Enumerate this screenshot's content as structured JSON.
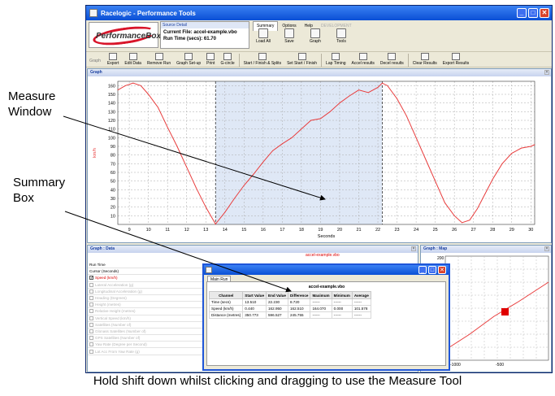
{
  "annotations": {
    "measure": [
      "Measure",
      "Window"
    ],
    "summary": [
      "Summary",
      "Box"
    ],
    "caption": "Hold shift down whilst clicking and dragging to use the Measure Tool"
  },
  "window": {
    "title": "Racelogic - Performance Tools"
  },
  "logo": {
    "text": "PerformanceBox"
  },
  "source_detail": {
    "header": "Source Detail",
    "current_file": "Current File: accel-example.vbo",
    "run_time": "Run Time (secs): 61.70"
  },
  "menu": {
    "tabs": [
      {
        "label": "Summary",
        "active": true
      },
      {
        "label": "Options",
        "active": false
      },
      {
        "label": "Help",
        "active": false
      },
      {
        "label": "DEVELOPMENT",
        "active": false,
        "disabled": true
      }
    ],
    "tools": [
      {
        "label": "Load All",
        "icon": "folder-icon"
      },
      {
        "label": "Save",
        "icon": "save-icon"
      },
      {
        "label": "Graph",
        "icon": "graph-icon"
      },
      {
        "label": "Tools",
        "icon": "tools-icon"
      }
    ]
  },
  "toolbar": {
    "group_label": "Graph",
    "items": [
      {
        "label": "Export",
        "icon": "export-icon"
      },
      {
        "label": "Edit Data",
        "icon": "edit-data-icon"
      },
      {
        "label": "Remove Run",
        "icon": "remove-run-icon"
      },
      {
        "label": "Graph Set-up",
        "icon": "graph-setup-icon"
      },
      {
        "label": "Print",
        "icon": "print-icon"
      },
      {
        "label": "G-circle",
        "icon": "g-circle-icon"
      },
      {
        "label": "Start / Finish & Splits",
        "icon": "start-finish-splits-icon"
      },
      {
        "label": "Set Start / Finish",
        "icon": "set-start-finish-icon"
      },
      {
        "label": "Lap Timing",
        "icon": "lap-timing-icon"
      },
      {
        "label": "Accel results",
        "icon": "accel-results-icon"
      },
      {
        "label": "Decel results",
        "icon": "decel-results-icon"
      },
      {
        "label": "Clear Results",
        "icon": "clear-results-icon"
      },
      {
        "label": "Export Results",
        "icon": "export-results-icon"
      }
    ]
  },
  "graph_panel": {
    "title": "Graph"
  },
  "chart_data": {
    "type": "line",
    "xlabel": "Seconds",
    "ylabel": "km/h",
    "xlim": [
      8.4,
      30.2
    ],
    "ylim": [
      0,
      165
    ],
    "xticks": [
      9,
      10,
      11,
      12,
      13,
      14,
      15,
      16,
      17,
      18,
      19,
      20,
      21,
      22,
      23,
      24,
      25,
      26,
      27,
      28,
      29,
      30
    ],
    "yticks": [
      10,
      20,
      30,
      40,
      50,
      60,
      70,
      80,
      90,
      100,
      110,
      120,
      130,
      140,
      150,
      160
    ],
    "grid": true,
    "measure_window": [
      13.51,
      22.23
    ],
    "series": [
      {
        "color": "#e83c3c",
        "x": [
          8.4,
          8.8,
          9.2,
          9.6,
          10.0,
          10.5,
          11.0,
          11.5,
          12.0,
          12.5,
          13.0,
          13.51,
          14.0,
          14.5,
          15.0,
          15.5,
          16.0,
          16.5,
          17.0,
          17.5,
          18.0,
          18.5,
          19.0,
          19.5,
          20.0,
          20.5,
          21.0,
          21.5,
          22.0,
          22.23,
          22.5,
          23.0,
          23.5,
          24.0,
          24.5,
          25.0,
          25.5,
          26.0,
          26.4,
          26.8,
          27.2,
          27.6,
          28.0,
          28.5,
          29.0,
          29.5,
          30.0,
          30.2
        ],
        "y": [
          155,
          160,
          163,
          160,
          150,
          135,
          112,
          90,
          66,
          42,
          20,
          0.44,
          14,
          30,
          45,
          58,
          72,
          85,
          93,
          100,
          110,
          120,
          122,
          130,
          140,
          148,
          155,
          152,
          158,
          162.95,
          160,
          145,
          125,
          100,
          75,
          50,
          25,
          10,
          2,
          5,
          18,
          35,
          52,
          70,
          82,
          88,
          90,
          92
        ]
      }
    ]
  },
  "data_panel": {
    "title": "Graph : Data",
    "file_label": "accel-example.vbo",
    "rows": [
      {
        "label": "Run Time",
        "checkbox": false,
        "on": false,
        "head": true
      },
      {
        "label": "Cursor (Seconds)",
        "checkbox": false,
        "on": false,
        "head": true
      },
      {
        "label": "Speed (km/h)",
        "checkbox": true,
        "on": true
      },
      {
        "label": "Lateral Acceleration (g)",
        "checkbox": true,
        "on": false
      },
      {
        "label": "Longitudinal Acceleration (g)",
        "checkbox": true,
        "on": false
      },
      {
        "label": "Heading (Degrees)",
        "checkbox": true,
        "on": false
      },
      {
        "label": "Height (metres)",
        "checkbox": true,
        "on": false
      },
      {
        "label": "Relative Height (metres)",
        "checkbox": true,
        "on": false
      },
      {
        "label": "Vertical Speed (km/h)",
        "checkbox": true,
        "on": false
      },
      {
        "label": "Satellites (Number of)",
        "checkbox": true,
        "on": false
      },
      {
        "label": "Glonass Satellites (Number of)",
        "checkbox": true,
        "on": false
      },
      {
        "label": "GPS Satellites (Number of)",
        "checkbox": true,
        "on": false
      },
      {
        "label": "Yaw Rate (Degree per Second)",
        "checkbox": true,
        "on": false
      },
      {
        "label": "Lat Acc From Yaw Rate (g)",
        "checkbox": true,
        "on": false
      }
    ]
  },
  "map_panel": {
    "title": "Graph : Map",
    "ytick": "200",
    "xticks": [
      "-1000",
      "-500"
    ]
  },
  "summary_window": {
    "tab": "Main Run",
    "file": "accel-example.vbo",
    "columns": [
      "Channel",
      "Start Value",
      "End Value",
      "Difference",
      "Maximum",
      "Minimum",
      "Average"
    ],
    "rows": [
      [
        "Time (secs)",
        "13.510",
        "22.230",
        "8.720",
        "------",
        "------",
        "------"
      ],
      [
        "Speed (km/h)",
        "0.440",
        "162.950",
        "162.510",
        "164.070",
        "0.000",
        "101.578"
      ],
      [
        "Distance (metres)",
        "350.773",
        "596.527",
        "245.755",
        "------",
        "------",
        "------"
      ]
    ]
  }
}
